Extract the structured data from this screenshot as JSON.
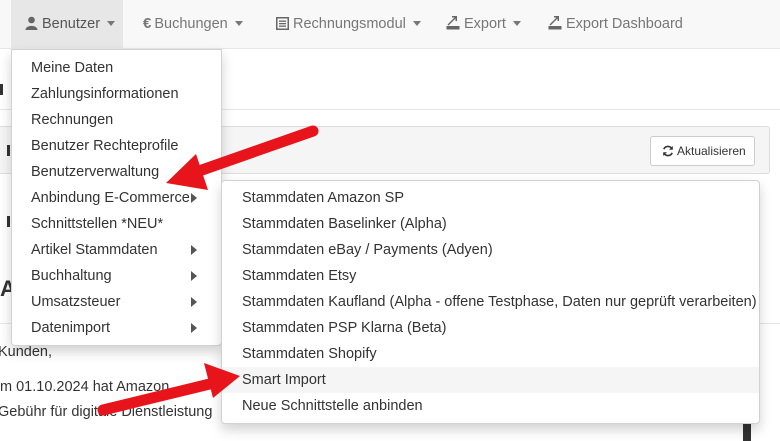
{
  "navbar": {
    "items": [
      {
        "label": "Benutzer",
        "icon": "user-icon",
        "caret": true
      },
      {
        "label": "Buchungen",
        "icon": "euro-icon",
        "caret": true
      },
      {
        "label": "Rechnungsmodul",
        "icon": "list-icon",
        "caret": true
      },
      {
        "label": "Export",
        "icon": "export-icon",
        "caret": true
      },
      {
        "label": "Export Dashboard",
        "icon": "export-icon",
        "caret": false
      }
    ]
  },
  "background": {
    "refresh_label": "Aktualisieren",
    "heading_fragment": "A",
    "line1": "Kunden,",
    "line2": "m 01.10.2024 hat Amazon",
    "line3": "Gebühr für digitale Dienstleistung"
  },
  "benutzer_menu": {
    "items": [
      {
        "label": "Meine Daten",
        "submenu": false
      },
      {
        "label": "Zahlungsinformationen",
        "submenu": false
      },
      {
        "label": "Rechnungen",
        "submenu": false
      },
      {
        "label": "Benutzer Rechteprofile",
        "submenu": false
      },
      {
        "label": "Benutzerverwaltung",
        "submenu": false
      },
      {
        "label": "Anbindung E-Commerce",
        "submenu": true
      },
      {
        "label": "Schnittstellen *NEU*",
        "submenu": false
      },
      {
        "label": "Artikel Stammdaten",
        "submenu": true
      },
      {
        "label": "Buchhaltung",
        "submenu": true
      },
      {
        "label": "Umsatzsteuer",
        "submenu": true
      },
      {
        "label": "Datenimport",
        "submenu": true
      }
    ]
  },
  "ecommerce_submenu": {
    "items": [
      {
        "label": "Stammdaten Amazon SP"
      },
      {
        "label": "Stammdaten Baselinker (Alpha)"
      },
      {
        "label": "Stammdaten eBay / Payments (Adyen)"
      },
      {
        "label": "Stammdaten Etsy"
      },
      {
        "label": "Stammdaten Kaufland (Alpha - offene Testphase, Daten nur geprüft verarbeiten)"
      },
      {
        "label": "Stammdaten PSP Klarna (Beta)"
      },
      {
        "label": "Stammdaten Shopify"
      },
      {
        "label": "Smart Import"
      },
      {
        "label": "Neue Schnittstelle anbinden"
      }
    ]
  },
  "colors": {
    "navbar_bg": "#f8f8f8",
    "nav_text": "#777777",
    "annotation_arrow": "#e8141b",
    "hover_bg": "#f5f5f5"
  }
}
